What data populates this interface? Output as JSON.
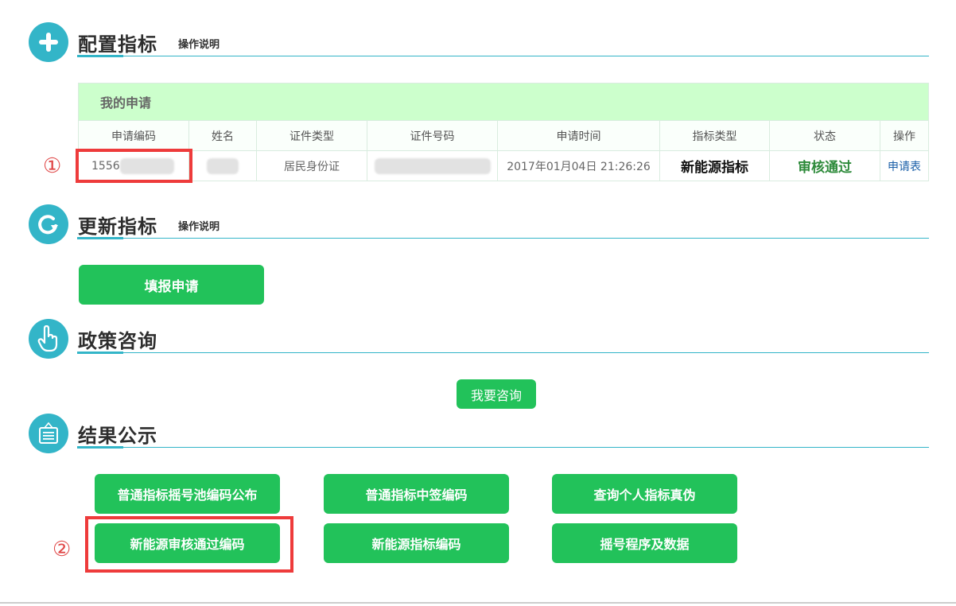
{
  "sections": {
    "config": {
      "title": "配置指标",
      "help_link": "操作说明",
      "icon": "plus-icon"
    },
    "update": {
      "title": "更新指标",
      "help_link": "操作说明",
      "icon": "refresh-icon"
    },
    "policy": {
      "title": "政策咨询",
      "icon": "pointing-hand-icon"
    },
    "results": {
      "title": "结果公示",
      "icon": "notice-board-icon"
    }
  },
  "applications": {
    "caption": "我的申请",
    "columns": [
      "申请编码",
      "姓名",
      "证件类型",
      "证件号码",
      "申请时间",
      "指标类型",
      "状态",
      "操作"
    ],
    "rows": [
      {
        "code_visible": "1556",
        "name": "",
        "id_type": "居民身份证",
        "id_number": "",
        "time": "2017年01月04日 21:26:26",
        "quota_type": "新能源指标",
        "status": "审核通过",
        "action": "申请表"
      }
    ]
  },
  "update_button": "填报申请",
  "consult_button": "我要咨询",
  "result_buttons": [
    "普通指标摇号池编码公布",
    "普通指标中签编码",
    "查询个人指标真伪",
    "新能源审核通过编码",
    "新能源指标编码",
    "摇号程序及数据"
  ],
  "annotations": {
    "marker1": "①",
    "marker2": "②"
  },
  "colors": {
    "accent": "#33b5c8",
    "button": "#22c25a",
    "caption_bg": "#ccffcc",
    "highlight": "#ee3b3b"
  }
}
